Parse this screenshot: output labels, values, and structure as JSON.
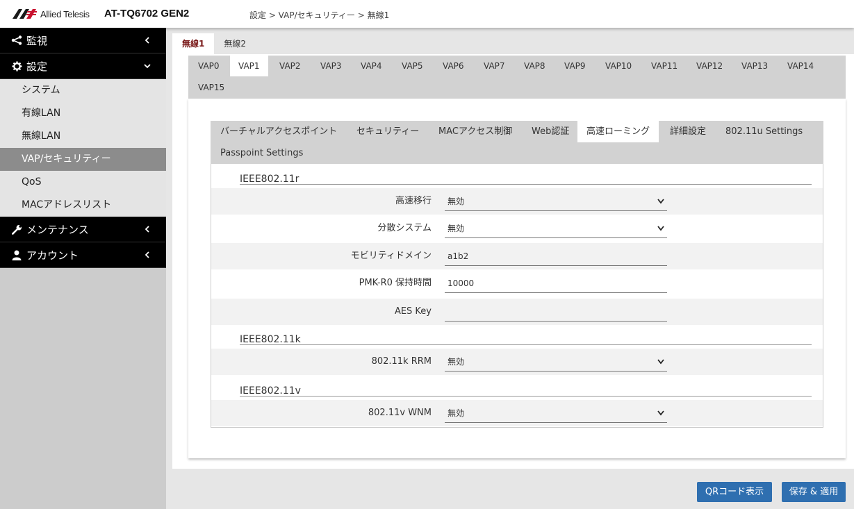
{
  "header": {
    "logo_text": "Allied Telesis",
    "model": "AT-TQ6702 GEN2",
    "breadcrumb": "設定 > VAP/セキュリティー > 無線1"
  },
  "sidebar": {
    "monitor": "監視",
    "settings": "設定",
    "items": [
      "システム",
      "有線LAN",
      "無線LAN",
      "VAP/セキュリティー",
      "QoS",
      "MACアドレスリスト"
    ],
    "maintenance": "メンテナンス",
    "account": "アカウント"
  },
  "radio_tabs": [
    "無線1",
    "無線2"
  ],
  "vap_tabs": [
    "VAP0",
    "VAP1",
    "VAP2",
    "VAP3",
    "VAP4",
    "VAP5",
    "VAP6",
    "VAP7",
    "VAP8",
    "VAP9",
    "VAP10",
    "VAP11",
    "VAP12",
    "VAP13",
    "VAP14",
    "VAP15"
  ],
  "sub_tabs": [
    "バーチャルアクセスポイント",
    "セキュリティー",
    "MACアクセス制御",
    "Web認証",
    "高速ローミング",
    "詳細設定",
    "802.11u Settings",
    "Passpoint Settings"
  ],
  "sections": {
    "r": "IEEE802.11r",
    "k": "IEEE802.11k",
    "v": "IEEE802.11v"
  },
  "fields": {
    "fast_transition": {
      "label": "高速移行",
      "value": "無効"
    },
    "distributed": {
      "label": "分散システム",
      "value": "無効"
    },
    "mobility_domain": {
      "label": "モビリティドメイン",
      "value": "a1b2"
    },
    "pmk_r0": {
      "label": "PMK-R0 保持時間",
      "value": "10000"
    },
    "aes_key": {
      "label": "AES Key",
      "value": ""
    },
    "rrm": {
      "label": "802.11k RRM",
      "value": "無効"
    },
    "wnm": {
      "label": "802.11v WNM",
      "value": "無効"
    }
  },
  "buttons": {
    "qr": "QRコード表示",
    "save": "保存 & 適用"
  },
  "colors": {
    "accent": "#2f6fb0",
    "active_radio_tab": "#7a1a1a",
    "sidebar_active": "#8c8c8c"
  }
}
